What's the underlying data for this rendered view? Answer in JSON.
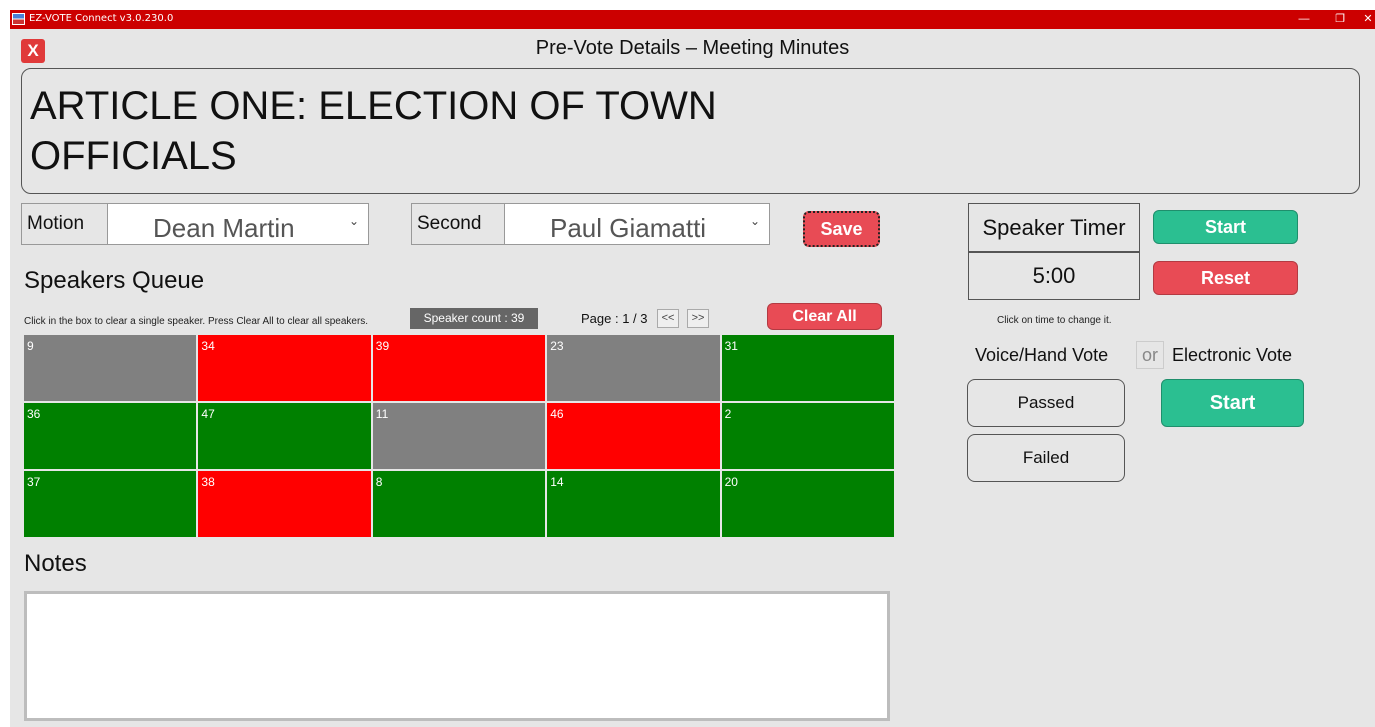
{
  "window": {
    "title": "EZ-VOTE Connect v3.0.230.0",
    "minimize": "—",
    "maximize": "❐",
    "close": "✕"
  },
  "header": {
    "close_label": "X",
    "heading": "Pre-Vote Details – Meeting Minutes"
  },
  "article": {
    "title": "ARTICLE ONE: ELECTION OF TOWN OFFICIALS"
  },
  "motion": {
    "label": "Motion",
    "value": "Dean Martin"
  },
  "second": {
    "label": "Second",
    "value": "Paul Giamatti"
  },
  "save_label": "Save",
  "speakers": {
    "title": "Speakers Queue",
    "hint": "Click in the box to clear a single speaker. Press Clear All to clear all speakers.",
    "count_text": "Speaker count :  39",
    "page_text": "Page : 1 / 3",
    "prev_label": "<<",
    "next_label": ">>",
    "clear_all_label": "Clear All",
    "cells": [
      {
        "num": "9",
        "status": "grey"
      },
      {
        "num": "34",
        "status": "red"
      },
      {
        "num": "39",
        "status": "red"
      },
      {
        "num": "23",
        "status": "grey"
      },
      {
        "num": "31",
        "status": "green"
      },
      {
        "num": "36",
        "status": "green"
      },
      {
        "num": "47",
        "status": "green"
      },
      {
        "num": "11",
        "status": "grey"
      },
      {
        "num": "46",
        "status": "red"
      },
      {
        "num": "2",
        "status": "green"
      },
      {
        "num": "37",
        "status": "green"
      },
      {
        "num": "38",
        "status": "red"
      },
      {
        "num": "8",
        "status": "green"
      },
      {
        "num": "14",
        "status": "green"
      },
      {
        "num": "20",
        "status": "green"
      }
    ]
  },
  "notes": {
    "title": "Notes",
    "value": ""
  },
  "timer": {
    "label": "Speaker Timer",
    "value": "5:00",
    "start_label": "Start",
    "reset_label": "Reset",
    "hint": "Click on time to change it."
  },
  "vote": {
    "voice_label": "Voice/Hand Vote",
    "or_label": "or",
    "electronic_label": "Electronic Vote",
    "passed_label": "Passed",
    "failed_label": "Failed",
    "start_label": "Start"
  },
  "colors": {
    "titlebar": "#cc0000",
    "red_button": "#e84b55",
    "green_button": "#2bbf91",
    "cell_grey": "#808080",
    "cell_red": "#ff0000",
    "cell_green": "#008000"
  }
}
